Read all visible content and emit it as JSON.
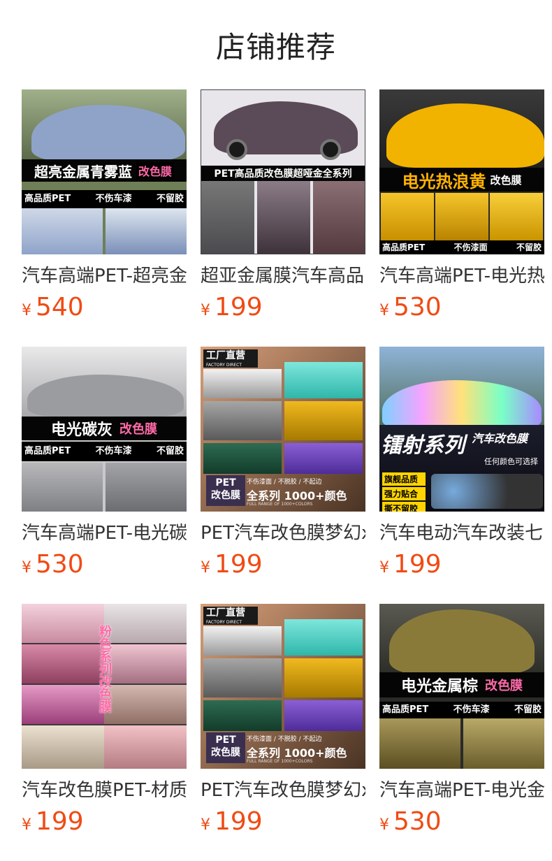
{
  "page": {
    "title": "店铺推荐"
  },
  "colors": {
    "price": "#f04b14",
    "title": "#222222",
    "name": "#333333"
  },
  "products": [
    {
      "name": "汽车高端PET-超亮金",
      "currency": "¥",
      "price": "540",
      "image": {
        "banner": "超亮金属青雾蓝",
        "tag": "改色膜",
        "sub": [
          "高品质PET",
          "不伤车漆",
          "不留胶"
        ],
        "car_color": "#8fa3c9"
      }
    },
    {
      "name": "超亚金属膜汽车高品",
      "currency": "¥",
      "price": "199",
      "image": {
        "banner": "PET高品质改色膜超哑金全系列",
        "car_color": "#5b4a57"
      }
    },
    {
      "name": "汽车高端PET-电光热",
      "currency": "¥",
      "price": "530",
      "image": {
        "banner": "电光热浪黄",
        "tag": "改色膜",
        "sub": [
          "高品质PET",
          "不伤漆面",
          "不留胶"
        ],
        "car_color": "#f2b200"
      }
    },
    {
      "name": "汽车高端PET-电光碳",
      "currency": "¥",
      "price": "530",
      "image": {
        "banner": "电光碳灰",
        "tag": "改色膜",
        "sub": [
          "高品质PET",
          "不伤车漆",
          "不留胶"
        ],
        "car_color": "#9a9ca0"
      }
    },
    {
      "name": "PET汽车改色膜梦幻x",
      "currency": "¥",
      "price": "199",
      "image": {
        "top_label": "工厂直营",
        "top_sub": "FACTORY DIRECT SALES",
        "pet_label": "PET",
        "pet_sub": "改色膜",
        "strip": "不伤漆面 / 不脱胶 / 不起边",
        "banner": "全系列 1000+颜色",
        "banner_sub": "FULL RANGE OF 1000+COLORS"
      }
    },
    {
      "name": "汽车电动汽车改装七",
      "currency": "¥",
      "price": "199",
      "image": {
        "banner": "镭射系列",
        "side": "汽车改色膜",
        "note": "任何颜色可选择",
        "badges": [
          "旗舰品质",
          "强力贴合",
          "撕不留胶"
        ]
      }
    },
    {
      "name": "汽车改色膜PET-材质",
      "currency": "¥",
      "price": "199",
      "image": {
        "vertical": "粉色系列改色膜",
        "car_color": "#e8a0b8"
      }
    },
    {
      "name": "PET汽车改色膜梦幻x",
      "currency": "¥",
      "price": "199",
      "image": {
        "top_label": "工厂直营",
        "top_sub": "FACTORY DIRECT SALES",
        "pet_label": "PET",
        "pet_sub": "改色膜",
        "strip": "不伤漆面 / 不脱胶 / 不起边",
        "banner": "全系列 1000+颜色",
        "banner_sub": "FULL RANGE OF 1000+COLORS"
      }
    },
    {
      "name": "汽车高端PET-电光金",
      "currency": "¥",
      "price": "530",
      "image": {
        "banner": "电光金属棕",
        "tag": "改色膜",
        "sub": [
          "高品质PET",
          "不伤车漆",
          "不留胶"
        ],
        "car_color": "#8a7a3a"
      }
    }
  ]
}
